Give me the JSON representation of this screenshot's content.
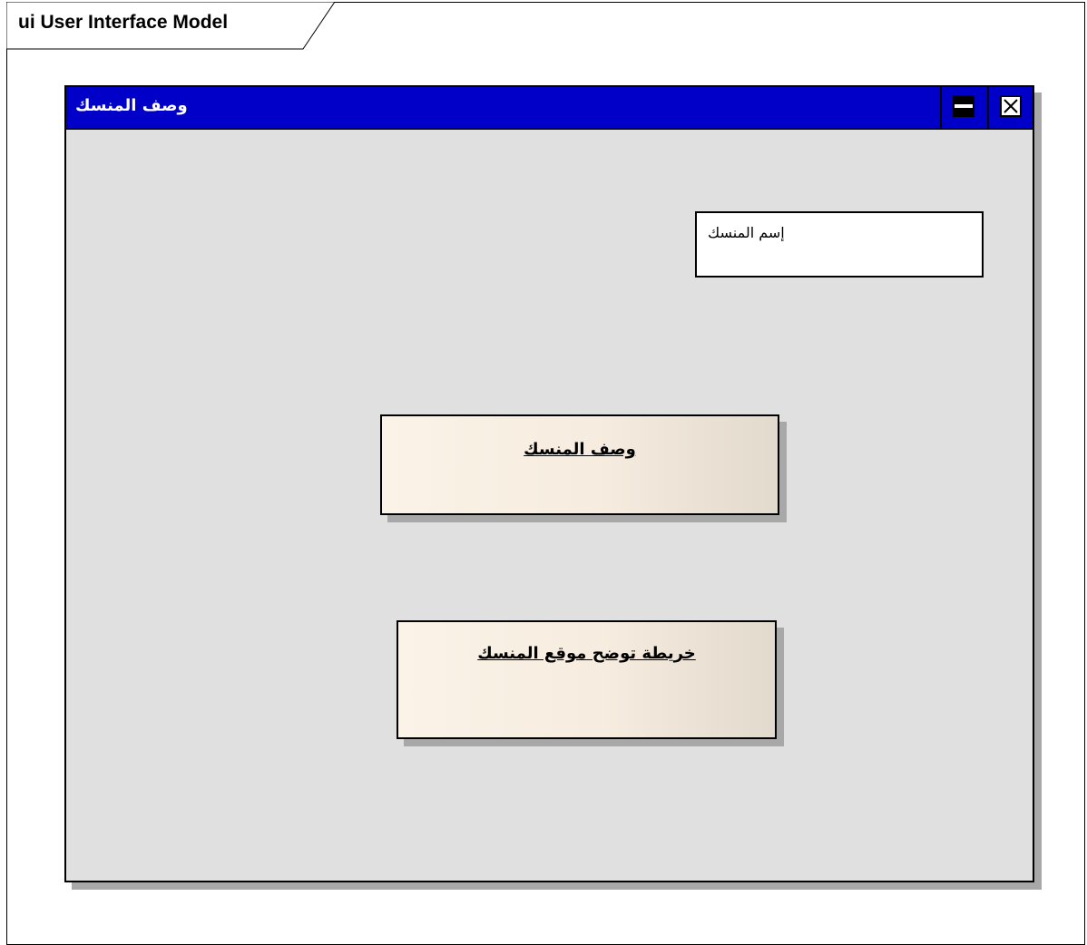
{
  "frame": {
    "label": "ui User Interface Model"
  },
  "window": {
    "title": "وصف المنسك",
    "maximize_icon": "maximize-icon",
    "close_icon": "close-x-icon",
    "name_field": {
      "text": "إسم المنسك"
    },
    "buttons": {
      "description_label": "وصف المنسك",
      "map_label": "خريطة توضح موقع المنسك"
    }
  },
  "colors": {
    "titlebar": "#0000c8",
    "window_bg": "#e0e0e0",
    "button_gradient_start": "#fbf3e8",
    "button_gradient_end": "#e2dacd"
  }
}
